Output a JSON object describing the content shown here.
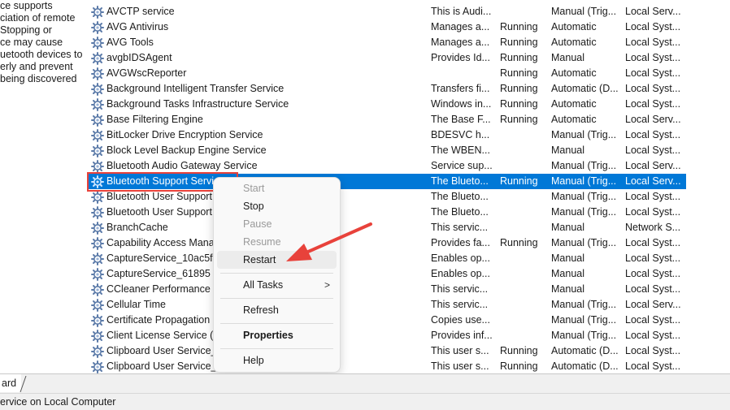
{
  "description_pane": {
    "lines": [
      "ce supports",
      "ciation of remote",
      " Stopping or",
      "ce may cause",
      "uetooth devices to",
      "erly and prevent",
      "being discovered"
    ]
  },
  "services": [
    {
      "name": "AVCTP service",
      "description": "This is Audi...",
      "status": "",
      "startup": "Manual (Trig...",
      "logon": "Local Serv..."
    },
    {
      "name": "AVG Antivirus",
      "description": "Manages a...",
      "status": "Running",
      "startup": "Automatic",
      "logon": "Local Syst..."
    },
    {
      "name": "AVG Tools",
      "description": "Manages a...",
      "status": "Running",
      "startup": "Automatic",
      "logon": "Local Syst..."
    },
    {
      "name": "avgbIDSAgent",
      "description": "Provides Id...",
      "status": "Running",
      "startup": "Manual",
      "logon": "Local Syst..."
    },
    {
      "name": "AVGWscReporter",
      "description": "",
      "status": "Running",
      "startup": "Automatic",
      "logon": "Local Syst..."
    },
    {
      "name": "Background Intelligent Transfer Service",
      "description": "Transfers fi...",
      "status": "Running",
      "startup": "Automatic (D...",
      "logon": "Local Syst..."
    },
    {
      "name": "Background Tasks Infrastructure Service",
      "description": "Windows in...",
      "status": "Running",
      "startup": "Automatic",
      "logon": "Local Syst..."
    },
    {
      "name": "Base Filtering Engine",
      "description": "The Base F...",
      "status": "Running",
      "startup": "Automatic",
      "logon": "Local Serv..."
    },
    {
      "name": "BitLocker Drive Encryption Service",
      "description": "BDESVC h...",
      "status": "",
      "startup": "Manual (Trig...",
      "logon": "Local Syst..."
    },
    {
      "name": "Block Level Backup Engine Service",
      "description": "The WBEN...",
      "status": "",
      "startup": "Manual",
      "logon": "Local Syst..."
    },
    {
      "name": "Bluetooth Audio Gateway Service",
      "description": "Service sup...",
      "status": "",
      "startup": "Manual (Trig...",
      "logon": "Local Serv..."
    },
    {
      "name": "Bluetooth Support Service",
      "description": "The Blueto...",
      "status": "Running",
      "startup": "Manual (Trig...",
      "logon": "Local Serv..."
    },
    {
      "name": "Bluetooth User Support",
      "description": "The Blueto...",
      "status": "",
      "startup": "Manual (Trig...",
      "logon": "Local Syst..."
    },
    {
      "name": "Bluetooth User Support",
      "description": "The Blueto...",
      "status": "",
      "startup": "Manual (Trig...",
      "logon": "Local Syst..."
    },
    {
      "name": "BranchCache",
      "description": "This servic...",
      "status": "",
      "startup": "Manual",
      "logon": "Network S..."
    },
    {
      "name": "Capability Access Mana",
      "description": "Provides fa...",
      "status": "Running",
      "startup": "Manual (Trig...",
      "logon": "Local Syst..."
    },
    {
      "name": "CaptureService_10ac5fl",
      "description": "Enables op...",
      "status": "",
      "startup": "Manual",
      "logon": "Local Syst..."
    },
    {
      "name": "CaptureService_61895",
      "description": "Enables op...",
      "status": "",
      "startup": "Manual",
      "logon": "Local Syst..."
    },
    {
      "name": "CCleaner Performance",
      "description": "This servic...",
      "status": "",
      "startup": "Manual",
      "logon": "Local Syst..."
    },
    {
      "name": "Cellular Time",
      "description": "This servic...",
      "status": "",
      "startup": "Manual (Trig...",
      "logon": "Local Serv..."
    },
    {
      "name": "Certificate Propagation",
      "description": "Copies use...",
      "status": "",
      "startup": "Manual (Trig...",
      "logon": "Local Syst..."
    },
    {
      "name": "Client License Service (",
      "description": "Provides inf...",
      "status": "",
      "startup": "Manual (Trig...",
      "logon": "Local Syst..."
    },
    {
      "name": "Clipboard User Service_",
      "description": "This user s...",
      "status": "Running",
      "startup": "Automatic (D...",
      "logon": "Local Syst..."
    },
    {
      "name": "Clipboard User Service_",
      "description": "This user s...",
      "status": "Running",
      "startup": "Automatic (D...",
      "logon": "Local Syst..."
    }
  ],
  "selected_index": 11,
  "context_menu": {
    "start": "Start",
    "stop": "Stop",
    "pause": "Pause",
    "resume": "Resume",
    "restart": "Restart",
    "all_tasks": "All Tasks",
    "all_tasks_arrow": ">",
    "refresh": "Refresh",
    "properties": "Properties",
    "help": "Help"
  },
  "tabs": {
    "active_tab": "ard"
  },
  "status_bar": {
    "text": "ervice on Local Computer"
  },
  "colors": {
    "selection": "#0078d7",
    "annotation": "#e8423b"
  },
  "icons": {
    "service": "gear-icon",
    "annotation_arrow": "red-arrow-icon"
  }
}
